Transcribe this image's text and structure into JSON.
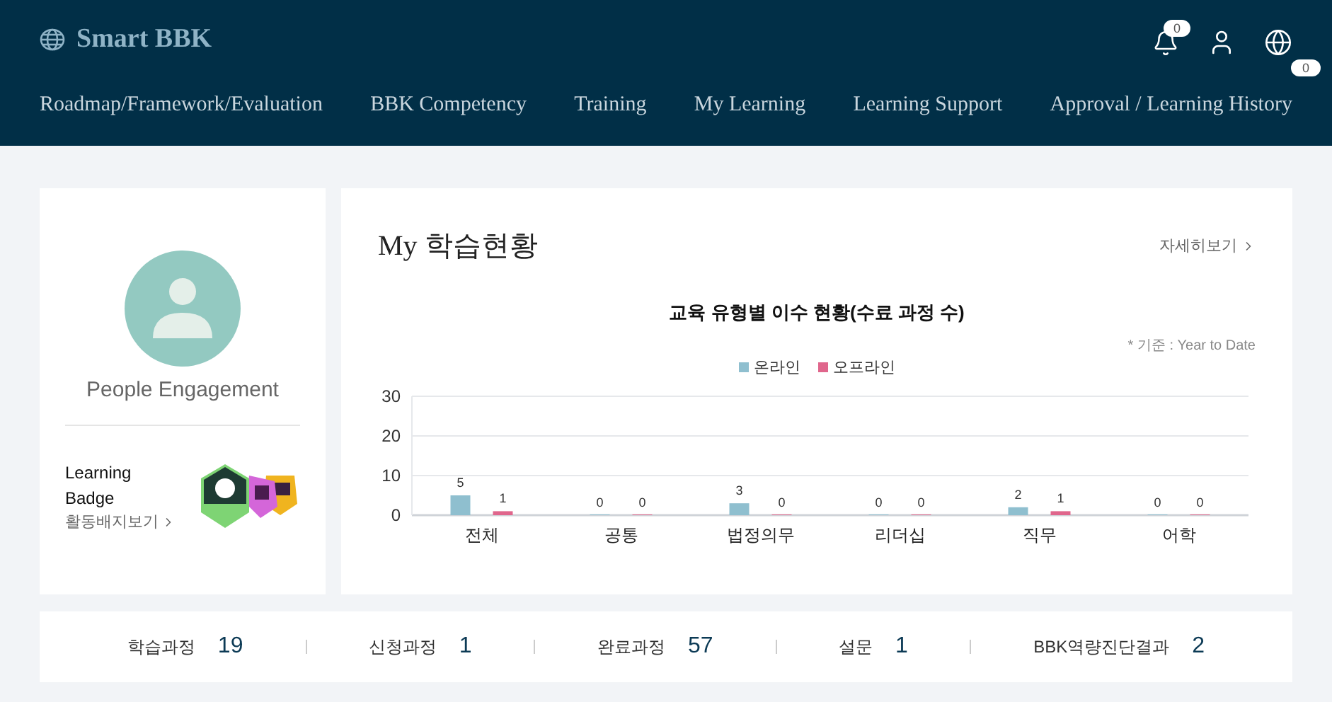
{
  "header": {
    "logo_text": "Smart BBK",
    "notification_count": "0",
    "nav": [
      {
        "label": "Roadmap/Framework/Evaluation"
      },
      {
        "label": "BBK Competency"
      },
      {
        "label": "Training"
      },
      {
        "label": "My Learning"
      },
      {
        "label": "Learning Support"
      },
      {
        "label": "Approval / Learning History",
        "badge": "0"
      }
    ]
  },
  "profile": {
    "name": "People Engagement",
    "badge_title": "Learning Badge",
    "badge_link": "활동배지보기"
  },
  "learning_status": {
    "title": "My 학습현황",
    "more_link": "자세히보기",
    "chart_title": "교육 유형별 이수 현황(수료 과정 수)",
    "basis_note": "* 기준 : Year to Date",
    "chart_data": {
      "type": "bar",
      "categories": [
        "전체",
        "공통",
        "법정의무",
        "리더십",
        "직무",
        "어학"
      ],
      "ylim": [
        0,
        30
      ],
      "yticks": [
        0,
        10,
        20,
        30
      ],
      "data_labels": true,
      "legend": "top",
      "series": [
        {
          "name": "온라인",
          "color": "#8fbfcf",
          "values": [
            5,
            0,
            3,
            0,
            2,
            0
          ]
        },
        {
          "name": "오프라인",
          "color": "#e0668c",
          "values": [
            1,
            0,
            0,
            0,
            1,
            0
          ]
        }
      ]
    }
  },
  "stats": [
    {
      "label": "학습과정",
      "value": "19"
    },
    {
      "label": "신청과정",
      "value": "1"
    },
    {
      "label": "완료과정",
      "value": "57"
    },
    {
      "label": "설문",
      "value": "1"
    },
    {
      "label": "BBK역량진단결과",
      "value": "2"
    }
  ]
}
